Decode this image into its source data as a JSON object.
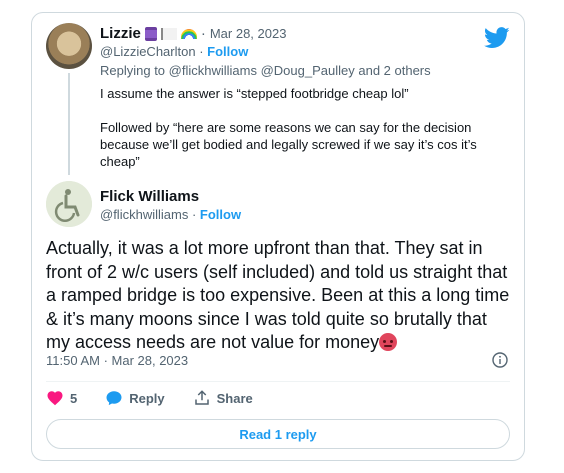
{
  "reply_tweet": {
    "display_name": "Lizzie",
    "emojis": [
      "spool-icon",
      "flag-icon",
      "rainbow-icon"
    ],
    "date": "Mar 28, 2023",
    "handle": "@LizzieCharlton",
    "follow_label": "Follow",
    "replying_prefix": "Replying to",
    "replying_mentions": "@flickhwilliams @Doug_Paulley and 2 others",
    "text": "I assume the answer is “stepped footbridge cheap lol”\n\nFollowed by “here are some reasons we can say for the decision because we’ll get bodied and legally screwed if we say it’s cos it’s cheap”"
  },
  "main_tweet": {
    "display_name": "Flick Williams",
    "handle": "@flickhwilliams",
    "follow_label": "Follow",
    "text": "Actually, it was a lot more upfront than that. They sat in front of 2 w/c users (self included) and told us straight that a ramped bridge is too expensive. Been at this a long time & it’s many moons since I was told quite so brutally that my access needs are not value for money",
    "emoji": "angry-face-icon",
    "timestamp": "11:50 AM · Mar 28, 2023"
  },
  "actions": {
    "like_count": "5",
    "reply_label": "Reply",
    "share_label": "Share"
  },
  "read_replies_label": "Read 1 reply",
  "colors": {
    "accent": "#1d9bf0",
    "like": "#f91880",
    "text_primary": "#0f1419",
    "text_secondary": "#536471",
    "border": "#cfd9de"
  }
}
